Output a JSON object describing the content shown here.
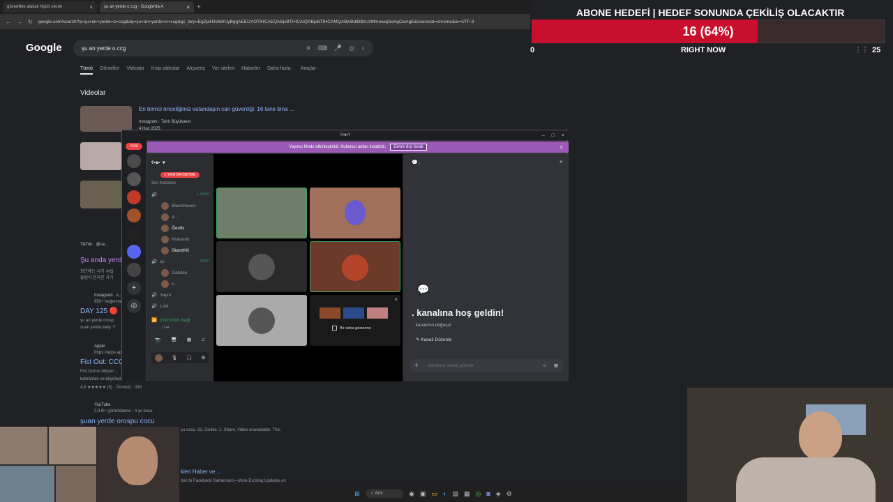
{
  "browser": {
    "tabs": [
      {
        "label": "güvenlikle alakalı hiçbir sıkıntı"
      },
      {
        "label": "şu an yerde o ccg - Google'da A"
      }
    ],
    "url": "google.com/search?q=şu+an+yerde+o+ccg&oq=şu+an+yerde+o+ccg&gs_lcrp=EgZjaHJvbWUyBggAEEUYOTIHCAEQABjvBTIHCAIQABjvBTIHCAMQABjvBdIBBzUzMmowajSoAgCwAgE&sourceid=chrome&ie=UTF-8"
  },
  "google": {
    "logo": "Google",
    "query": "şu an yerde o ccg",
    "nav": [
      "Tümü",
      "Görseller",
      "Videolar",
      "Kısa videolar",
      "Alışveriş",
      "Yer siteleri",
      "Haberler",
      "Daha fazla ·",
      "Araçlar ·"
    ],
    "videos_heading": "Videolar",
    "video1": {
      "title": "En birinci önceliğimiz vatandaşın can güvenliği. 16 tane bina ...",
      "source": "Instagram · Tahir Büyükakın",
      "date": "4 Haz 2025"
    },
    "tiktok": {
      "source": "TikTok · @ue...",
      "title": "Şu anda yerde",
      "snippet1": "최근에는 사기 수법",
      "snippet2": "돌림이 온라인 사기"
    },
    "instagram": {
      "source": "Instagram · s...",
      "meta": "950+ beğenme",
      "title": "DAY 125 🔴",
      "snippet1": "şu an yerde orosp",
      "snippet2": "suan yerde.daily. Y"
    },
    "apple": {
      "source": "Apple",
      "meta": "https://apps.ap",
      "title": "Fist Out: CCG",
      "snippet1": "Fist Out'un düşsel ...",
      "snippet2": "kahraman ve büyüleyici bölgeleri PVP'deki rakiplere ...",
      "rating": "4,8 ★★★★★ (5) · Ücretsiz · iOS"
    },
    "youtube": {
      "source": "YouTube",
      "meta": "2,9 B+ görüntüleme · 4 yıl önce",
      "title": "şuan yerde orospu cocu",
      "snippet": "şu cocu. 62. Dislike. 1. Share. Video unavailable. This"
    },
    "bottom": {
      "title": "kleri Haber ve ...",
      "snippet": "tion to Facebook Gameroom—More Exciting Updates on"
    }
  },
  "goal": {
    "title": "ABONE HEDEFİ | HEDEF SONUNDA ÇEKİLİŞ OLACAKTIR",
    "progress_text": "16 (64%)",
    "progress_percent": 64,
    "start": "0",
    "label": "RIGHT NOW",
    "count": "25",
    "bar_color": "#c8102e"
  },
  "discord": {
    "window_title": "ʕ•ᴥ•ʔ",
    "new_badge": "YENİ",
    "banner_text": "Yayıncı Modu etkinleştirildi. Kullanıcı adları kısaltıldı.",
    "banner_button": "Devre dışı bırak",
    "server_name": "ʕ•ᴥ•",
    "new_mentions": "1 YENİ BAHSETME",
    "voice_header": "Ses Kanalları",
    "channels": [
      {
        "name": ".",
        "time": "1:40:58"
      },
      {
        "name": "ss",
        "time": "30:03"
      },
      {
        "name": "Yayın",
        "time": ""
      },
      {
        "name": "Lobi",
        "time": ""
      }
    ],
    "users_ch1": [
      "BlackRaven",
      "d...",
      "Ĝesfis",
      "Kraisnoh",
      "SkorzKK"
    ],
    "users_ch2": [
      "Gabilan",
      "s..."
    ],
    "voice_status": "Görüntülü Bağl",
    "voice_sub": "./ ʕ•ᴥ",
    "dismiss_label": "Bir daha gösterme",
    "welcome_title": ". kanalına hoş geldin!",
    "welcome_sub": ". kanalının doğuşu!",
    "edit_channel": "Kanalı Düzenle",
    "message_placeholder": ". kanalına mesaj gönder",
    "chat_header": "."
  },
  "taskbar": {
    "search_placeholder": "Ara"
  }
}
